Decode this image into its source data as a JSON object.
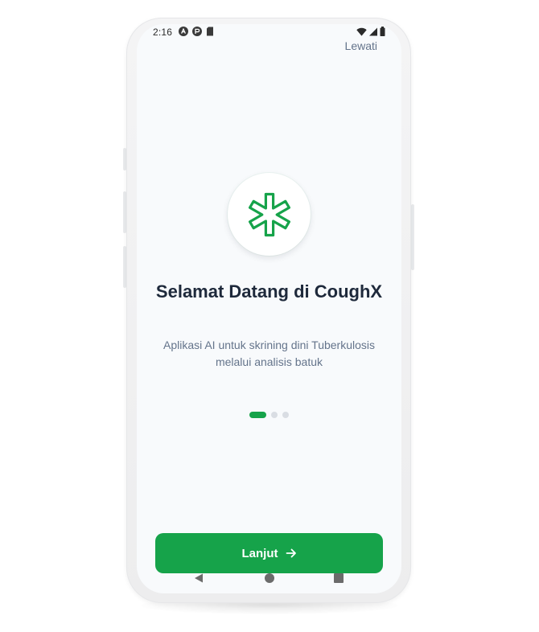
{
  "status_bar": {
    "time": "2:16",
    "left_icons": [
      "notification-a-icon",
      "notification-b-icon",
      "sd-card-icon"
    ],
    "right_icons": [
      "wifi-icon",
      "signal-icon",
      "battery-icon"
    ]
  },
  "header": {
    "skip_label": "Lewati"
  },
  "onboarding": {
    "logo_icon": "asterisk-medical-icon",
    "title": "Selamat Datang di CoughX",
    "subtitle": "Aplikasi AI untuk skrining dini Tuberkulosis melalui analisis batuk",
    "page_indicator": {
      "total": 3,
      "current": 1
    }
  },
  "footer": {
    "next_label": "Lanjut",
    "next_icon": "arrow-right-icon"
  },
  "system_nav": {
    "items": [
      "back-icon",
      "home-icon",
      "recents-icon"
    ]
  },
  "colors": {
    "accent": "#16a34a",
    "background": "#f8fafc",
    "title": "#1e293b",
    "muted": "#64748b"
  }
}
